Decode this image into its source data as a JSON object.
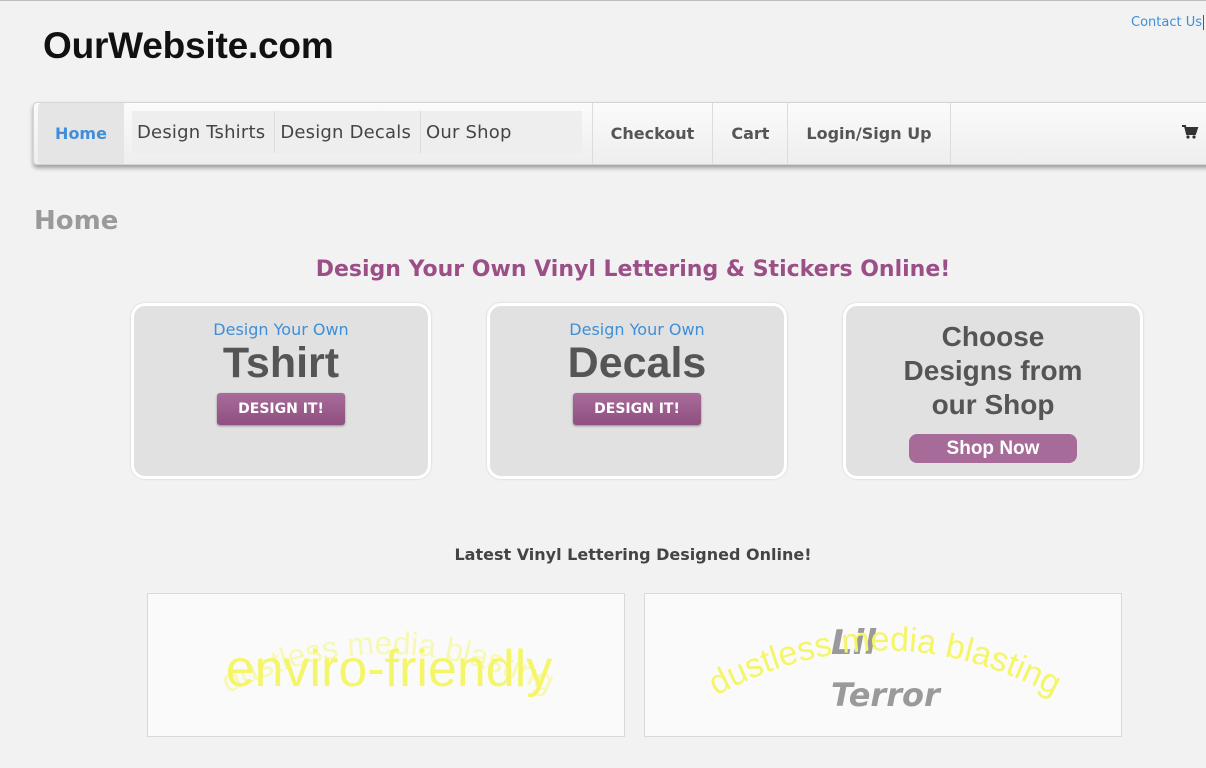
{
  "site": {
    "title": "OurWebsite.com",
    "contact": "Contact Us"
  },
  "nav": {
    "home": "Home",
    "group": [
      "Design Tshirts",
      "Design Decals",
      "Our Shop"
    ],
    "right": [
      "Checkout",
      "Cart",
      "Login/Sign Up"
    ],
    "cart_icon": "shopping-cart-icon"
  },
  "page": {
    "heading": "Home",
    "tagline": "Design Your Own Vinyl Lettering & Stickers Online!"
  },
  "cards": [
    {
      "sub": "Design Your Own",
      "big": "Tshirt",
      "button": "DESIGN IT!"
    },
    {
      "sub": "Design Your Own",
      "big": "Decals",
      "button": "DESIGN IT!"
    },
    {
      "lines": [
        "Choose",
        "Designs from",
        "our Shop"
      ],
      "button": "Shop Now"
    }
  ],
  "latest": {
    "heading": "Latest Vinyl Lettering Designed Online!",
    "designs": [
      {
        "arc_text": "dustless media blasting",
        "main_text": "enviro-friendly",
        "color": "#f5f56a"
      },
      {
        "arc_text": "dustless media blasting",
        "line1": "Lil",
        "line2": "Terror",
        "color": "#f5f56a",
        "text_color": "#9a9a9a"
      }
    ]
  },
  "colors": {
    "accent_blue": "#3f8fd8",
    "accent_purple": "#9b4f86",
    "button_purple": "#a66b98"
  }
}
